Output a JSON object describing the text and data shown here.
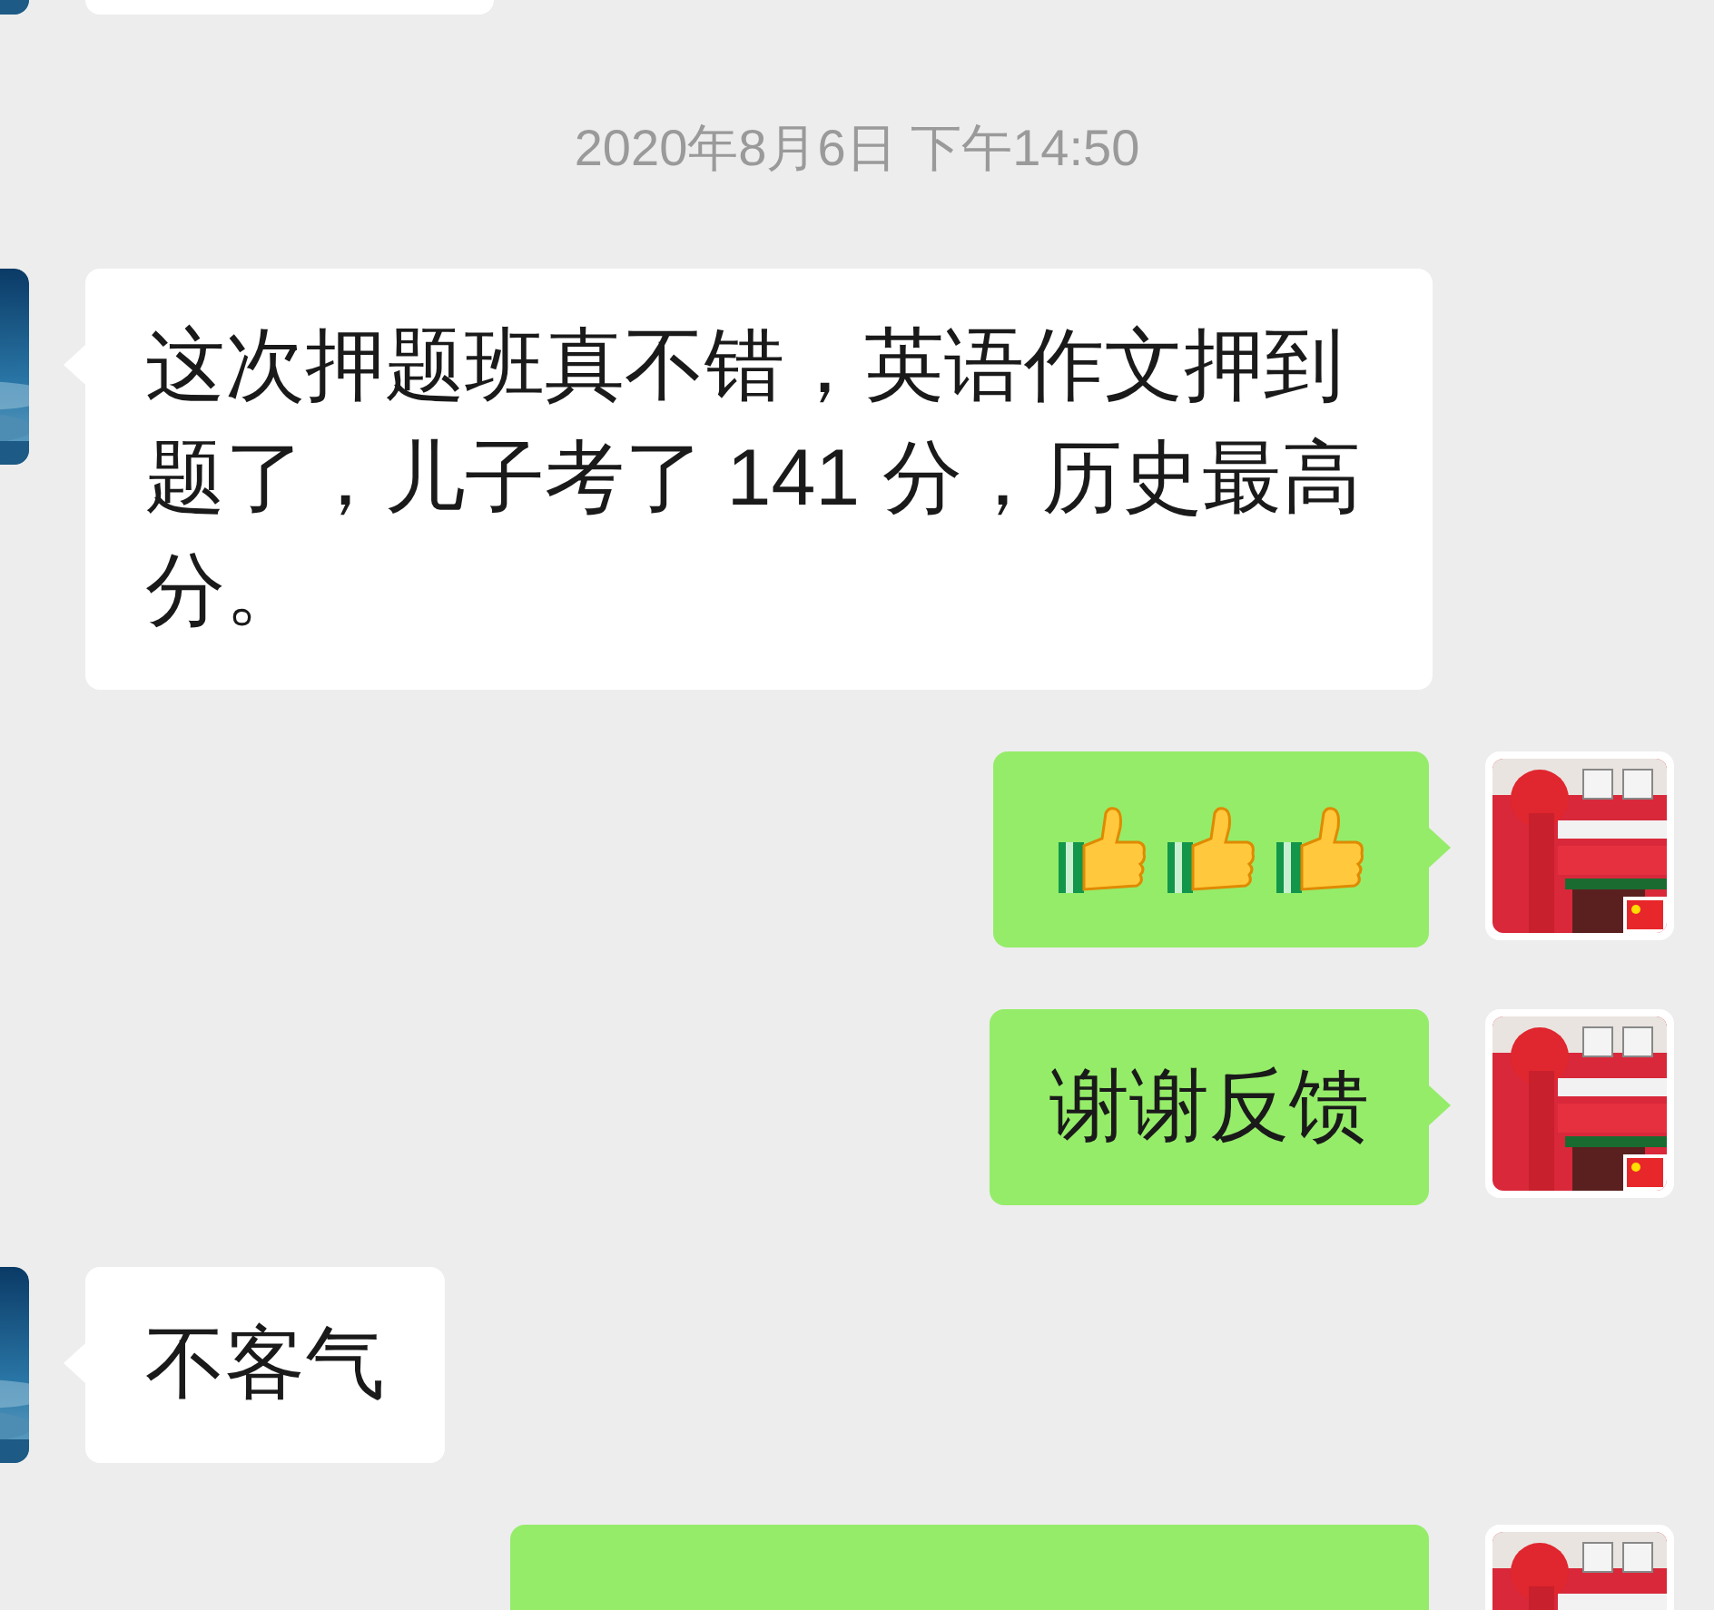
{
  "items": [
    {
      "kind": "partial",
      "outgoing": false
    },
    {
      "kind": "timestamp",
      "text": "2020年8月6日 下午14:50"
    },
    {
      "kind": "text",
      "outgoing": false,
      "text": "这次押题班真不错，英语作文押到题了，儿子考了 141 分，历史最高分。"
    },
    {
      "kind": "emoji",
      "outgoing": true,
      "emoji": [
        {
          "kind": "thumbs_up"
        },
        {
          "kind": "thumbs_up"
        },
        {
          "kind": "thumbs_up"
        }
      ]
    },
    {
      "kind": "text",
      "outgoing": true,
      "text": "谢谢反馈"
    },
    {
      "kind": "text",
      "outgoing": false,
      "text": "不客气"
    },
    {
      "kind": "partial",
      "outgoing": true
    }
  ]
}
